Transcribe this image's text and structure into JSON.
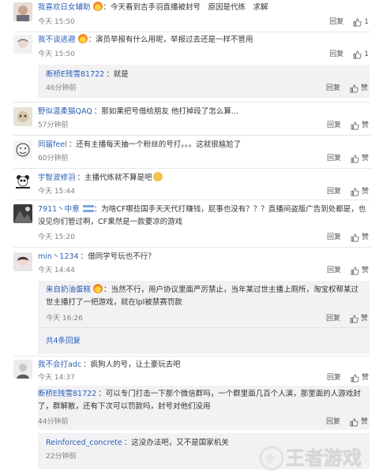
{
  "comments": [
    {
      "name": "我喜欢日女辅助",
      "after_name_emoji": "fire",
      "text": "今天看到吉手羽直播被封号　原因是代练　求解",
      "time": "今天 15:50",
      "reply": "回复",
      "likes": "1"
    },
    {
      "name": "我不谈逃避",
      "after_name_emoji": "fire",
      "text": "演员举报有什么用呢，举报过去还是一样不管用",
      "time": "今天 15:50",
      "reply": "回复",
      "likes": "1",
      "sub": {
        "name": "断桥E残雪81722",
        "text": "就是",
        "time": "46分钟前",
        "reply": "回复",
        "likes": "赞"
      }
    },
    {
      "name": "野似温柔猫QAQ",
      "text": "那如果把号借给朋友 他打掉段了怎么算...",
      "time": "57分钟前",
      "reply": "回复",
      "likes": "赞"
    },
    {
      "name": "同届feel",
      "text": "还有主播每天抽一个粉丝的号打。。。这就很尴尬了",
      "time": "60分钟前",
      "reply": "回复",
      "likes": "赞"
    },
    {
      "name": "宇智波修羽",
      "text": "主播代练就不算是吧",
      "time": "今天 15:44",
      "reply": "回复",
      "likes": "赞"
    },
    {
      "name": "7911丶中意",
      "text": "为啥CF哪些国手天天代打赚钱，屁事也没有？？？直播间盗版广告到处都是，也没见你们管过啊，CF果然是一款要凉的游戏",
      "time": "今天 15:20",
      "reply": "回复",
      "likes": "赞"
    },
    {
      "name": "min丶1234",
      "text": "借同学号玩也不行？",
      "time": "今天 14:44",
      "reply": "回复",
      "likes": "赞",
      "sub": {
        "name": "来自奶油蛋糕",
        "after_name_emoji": "fire",
        "text": "当然不行，用户协议里面严厉禁止，当年某过世主播上厕所，淘宝权帮某过世主播打了一把游戏，就在lpl被禁赛罚款",
        "time": "今天 16:26",
        "reply": "回复",
        "likes": "赞",
        "more": "共4条回复"
      }
    },
    {
      "name": "我不会打adc",
      "text": "疯狗人的号，让土豪玩去吧",
      "time": "今天 14:37",
      "reply": "回复",
      "likes": "赞"
    }
  ],
  "tail": {
    "box1": {
      "name": "断桥E残雪81722",
      "text": "可以专门打击一下那个微信群吗，一个群里面几百个人演，那里面的人游戏封了，群解散，还有下次可以罚款吗，封号对他们没用",
      "time": "44分钟前",
      "reply": "回复",
      "likes": "赞"
    },
    "box2": {
      "name": "Reinforced_concrete",
      "text": "这没办法吧，又不是国家机关",
      "time": "22分钟前"
    }
  },
  "watermark": "王者游戏"
}
